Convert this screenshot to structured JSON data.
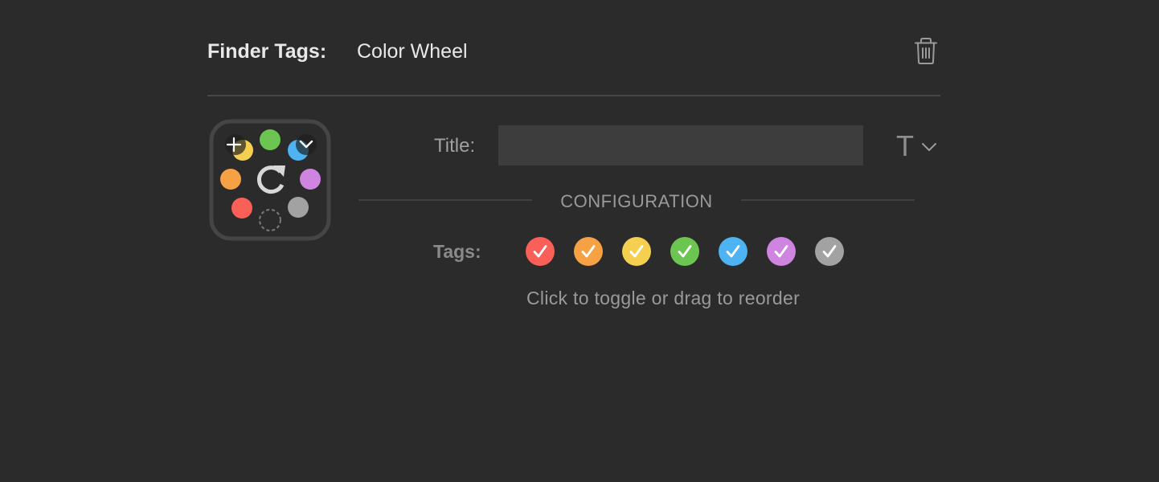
{
  "header": {
    "label": "Finder Tags:",
    "value": "Color Wheel",
    "delete_icon": "trash-icon"
  },
  "icon_preview": {
    "icons": [
      "plus-icon",
      "checkmark-icon",
      "refresh-icon",
      "dashed-circle-icon"
    ],
    "dot_colors": {
      "green": "#6cc551",
      "yellow": "#f5cf4f",
      "blue": "#4eb3f2",
      "orange": "#f7a145",
      "purple": "#cf84e0",
      "red": "#fa5f58",
      "gray": "#a2a2a2"
    }
  },
  "form": {
    "title_label": "Title:",
    "title_value": "",
    "title_placeholder": "",
    "font_button_glyph": "T",
    "font_button_icon": "chevron-down-icon"
  },
  "section": {
    "title": "CONFIGURATION"
  },
  "tags": {
    "label": "Tags:",
    "items": [
      {
        "name": "Red",
        "color": "#fa5f58",
        "checked": true
      },
      {
        "name": "Orange",
        "color": "#f7a145",
        "checked": true
      },
      {
        "name": "Yellow",
        "color": "#f5cf4f",
        "checked": true
      },
      {
        "name": "Green",
        "color": "#6cc551",
        "checked": true
      },
      {
        "name": "Blue",
        "color": "#4eb3f2",
        "checked": true
      },
      {
        "name": "Purple",
        "color": "#cf84e0",
        "checked": true
      },
      {
        "name": "Gray",
        "color": "#a2a2a2",
        "checked": true
      }
    ],
    "hint": "Click to toggle or drag to reorder"
  }
}
